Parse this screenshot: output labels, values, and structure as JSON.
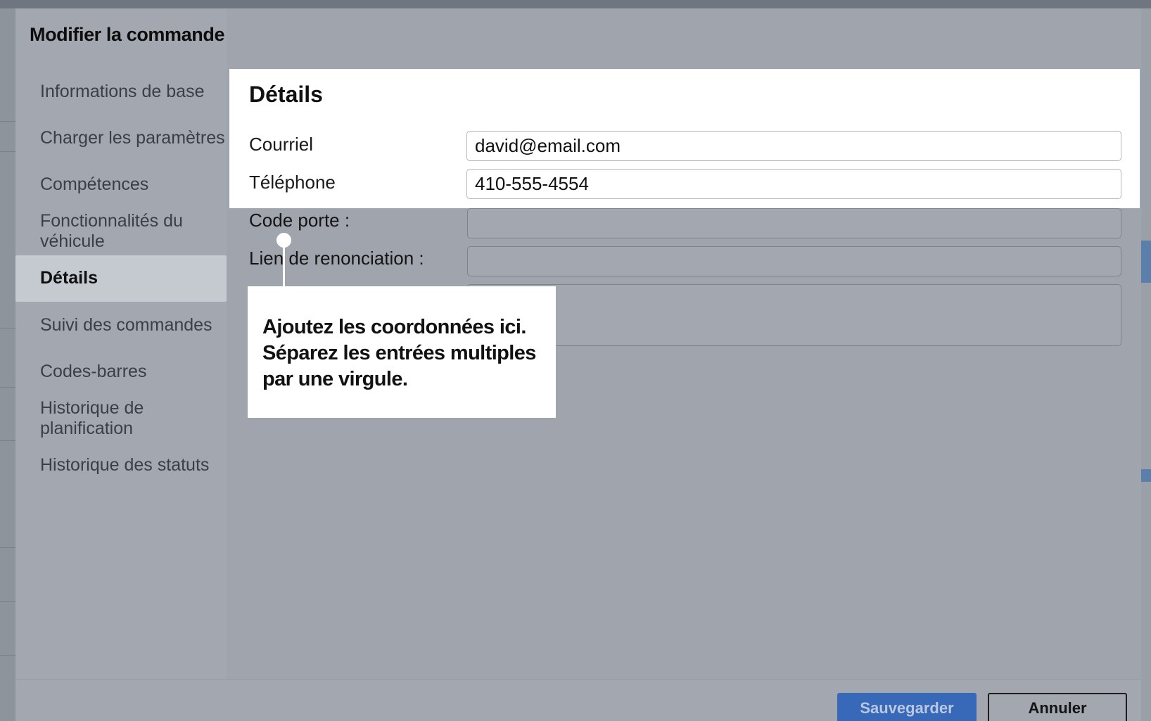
{
  "modal": {
    "title": "Modifier la commande"
  },
  "sidebar": {
    "items": [
      {
        "label": "Informations de base",
        "active": false
      },
      {
        "label": "Charger les paramètres",
        "active": false
      },
      {
        "label": "Compétences",
        "active": false
      },
      {
        "label": "Fonctionnalités du véhicule",
        "active": false
      },
      {
        "label": "Détails",
        "active": true
      },
      {
        "label": "Suivi des commandes",
        "active": false
      },
      {
        "label": "Codes-barres",
        "active": false
      },
      {
        "label": "Historique de planification",
        "active": false
      },
      {
        "label": "Historique des statuts",
        "active": false
      }
    ]
  },
  "details": {
    "title": "Détails",
    "email_label": "Courriel",
    "email_value": "david@email.com",
    "phone_label": "Téléphone",
    "phone_value": "410-555-4554",
    "door_code_label": "Code porte :",
    "door_code_value": "",
    "waiver_link_label": "Lien de renonciation :",
    "waiver_link_value": "",
    "notes_value": ""
  },
  "tooltip": {
    "text": "Ajoutez les coordonnées ici. Séparez les entrées multiples par une virgule."
  },
  "footer": {
    "save_label": "Sauvegarder",
    "cancel_label": "Annuler"
  },
  "colors": {
    "accent": "#3868b8",
    "overlay": "#a3a8b0",
    "highlight": "#ffffff"
  }
}
